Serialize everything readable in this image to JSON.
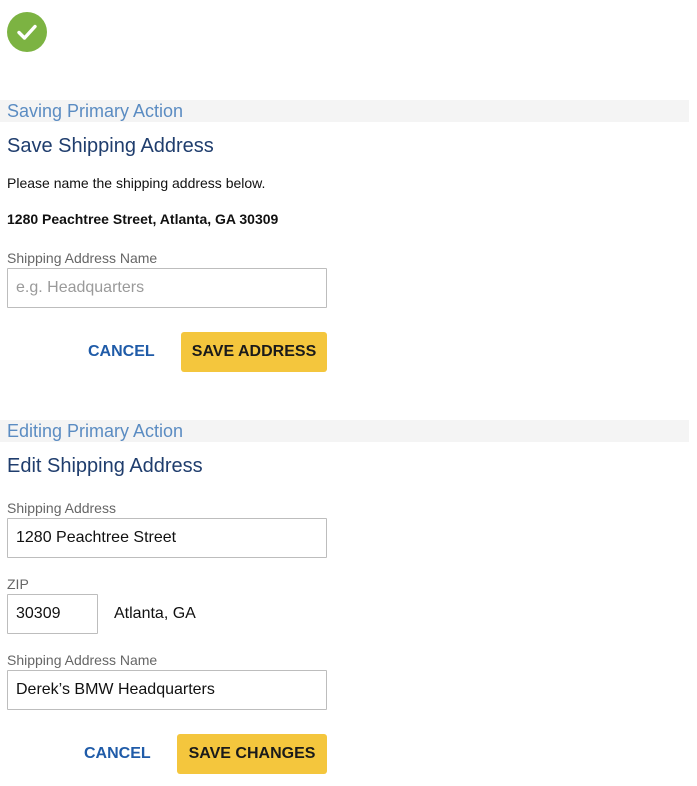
{
  "colors": {
    "success": "#7cb342",
    "section_label": "#5b8cc2",
    "title": "#1f3d6d",
    "link": "#1f5ba8",
    "primary_button": "#f4c63d"
  },
  "status_icon": "check-circle-icon",
  "saving": {
    "section_label": "Saving Primary Action",
    "title": "Save Shipping Address",
    "instruction": "Please name the shipping address below.",
    "address": "1280 Peachtree Street, Atlanta, GA 30309",
    "name_field": {
      "label": "Shipping Address Name",
      "value": "",
      "placeholder": "e.g. Headquarters"
    },
    "cancel_label": "CANCEL",
    "save_label": "SAVE ADDRESS"
  },
  "editing": {
    "section_label": "Editing Primary Action",
    "title": "Edit Shipping Address",
    "address_field": {
      "label": "Shipping Address",
      "value": "1280 Peachtree Street"
    },
    "zip_field": {
      "label": "ZIP",
      "value": "30309",
      "city": "Atlanta, GA"
    },
    "name_field": {
      "label": "Shipping Address Name",
      "value": "Derek’s BMW Headquarters"
    },
    "cancel_label": "CANCEL",
    "save_label": "SAVE CHANGES"
  }
}
